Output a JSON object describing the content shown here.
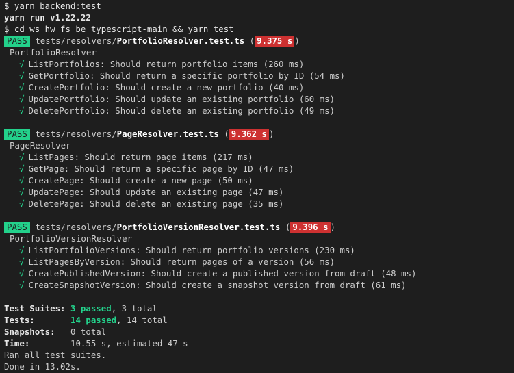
{
  "commands": {
    "cmd1": "$ yarn backend:test",
    "yarn_version": "yarn run v1.22.22",
    "cmd2": "$ cd ws_hw_fs_be_typescript-main && yarn test"
  },
  "suites": [
    {
      "status": "PASS",
      "path_prefix": "tests/resolvers/",
      "file": "PortfolioResolver.test.ts",
      "time": "9.375 s",
      "describe": "PortfolioResolver",
      "tests": [
        "ListPortfolios: Should return portfolio items (260 ms)",
        "GetPortfolio: Should return a specific portfolio by ID (54 ms)",
        "CreatePortfolio: Should create a new portfolio (40 ms)",
        "UpdatePortfolio: Should update an existing portfolio (60 ms)",
        "DeletePortfolio: Should delete an existing portfolio (49 ms)"
      ]
    },
    {
      "status": "PASS",
      "path_prefix": "tests/resolvers/",
      "file": "PageResolver.test.ts",
      "time": "9.362 s",
      "describe": "PageResolver",
      "tests": [
        "ListPages: Should return page items (217 ms)",
        "GetPage: Should return a specific page by ID (47 ms)",
        "CreatePage: Should create a new page (50 ms)",
        "UpdatePage: Should update an existing page (47 ms)",
        "DeletePage: Should delete an existing page (35 ms)"
      ]
    },
    {
      "status": "PASS",
      "path_prefix": "tests/resolvers/",
      "file": "PortfolioVersionResolver.test.ts",
      "time": "9.396 s",
      "describe": "PortfolioVersionResolver",
      "tests": [
        "ListPortfolioVersions: Should return portfolio versions (230 ms)",
        "ListPagesByVersion: Should return pages of a version (56 ms)",
        "CreatePublishedVersion: Should create a published version from draft (48 ms)",
        "CreateSnapshotVersion: Should create a snapshot version from draft (61 ms)"
      ]
    }
  ],
  "check_glyph": "√",
  "summary": {
    "suites_label": "Test Suites:",
    "suites_passed": "3 passed",
    "suites_total": ", 3 total",
    "tests_label": "Tests:",
    "tests_passed": "14 passed",
    "tests_total": ", 14 total",
    "snapshots_label": "Snapshots:",
    "snapshots_value": "0 total",
    "time_label": "Time:",
    "time_value": "10.55 s, estimated 47 s",
    "ran_all": "Ran all test suites.",
    "done": "Done in 13.02s."
  },
  "colors": {
    "background": "#1e1e1e",
    "pass_badge": "#23d18b",
    "slow_time_badge": "#cd3131",
    "check": "#23d18b"
  }
}
